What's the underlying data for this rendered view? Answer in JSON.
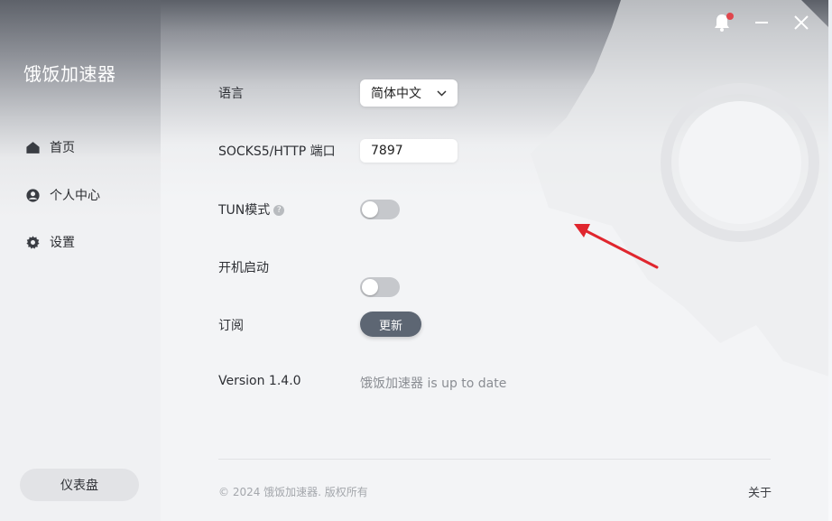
{
  "app": {
    "title": "饿饭加速器"
  },
  "sidebar": {
    "items": [
      {
        "label": "首页",
        "icon": "home-icon"
      },
      {
        "label": "个人中心",
        "icon": "user-icon"
      },
      {
        "label": "设置",
        "icon": "gear-icon"
      }
    ],
    "dashboard_label": "仪表盘"
  },
  "settings": {
    "language": {
      "label": "语言",
      "value": "简体中文"
    },
    "port": {
      "label": "SOCKS5/HTTP 端口",
      "value": "7897"
    },
    "tun": {
      "label": "TUN模式",
      "help": "?",
      "on": false
    },
    "autostart": {
      "label": "开机启动",
      "on": false
    },
    "subscription": {
      "label": "订阅",
      "button": "更新"
    },
    "version": {
      "label": "Version 1.4.0",
      "status": "饿饭加速器 is up to date"
    }
  },
  "footer": {
    "copyright": "© 2024 饿饭加速器. 版权所有",
    "about": "关于"
  },
  "colors": {
    "accent_button": "#5d6673",
    "notify_dot": "#e0464d",
    "annotation_arrow": "#e0262e"
  }
}
